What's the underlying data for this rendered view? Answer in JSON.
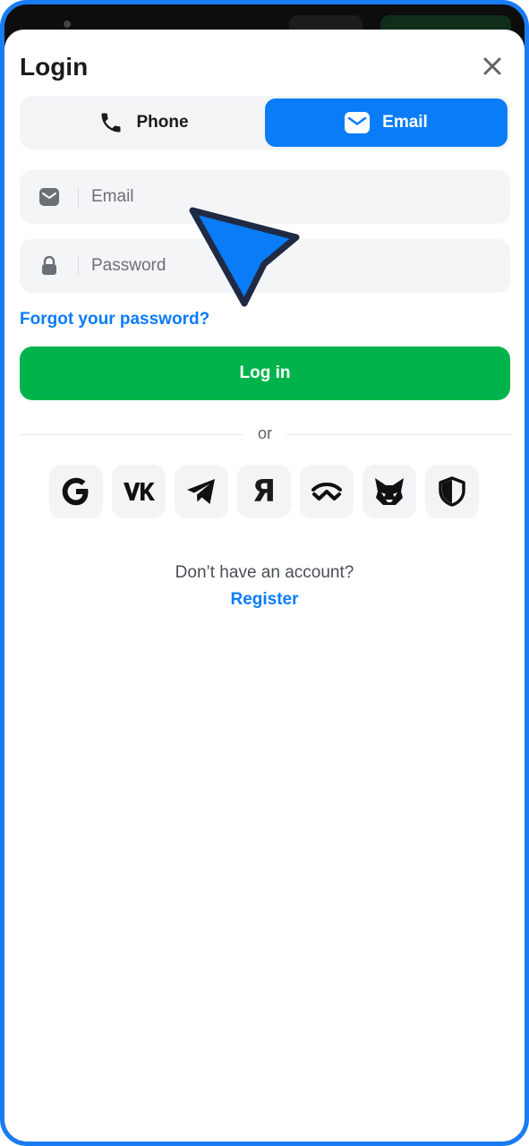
{
  "dialog": {
    "title": "Login"
  },
  "tabs": [
    {
      "label": "Phone",
      "icon": "phone-icon",
      "active": false
    },
    {
      "label": "Email",
      "icon": "envelope-icon",
      "active": true
    }
  ],
  "form": {
    "email_placeholder": "Email",
    "email_value": "",
    "password_placeholder": "Password",
    "password_value": "",
    "forgot_label": "Forgot your password?",
    "login_label": "Log in"
  },
  "divider_label": "or",
  "socials": [
    {
      "icon": "google-icon"
    },
    {
      "icon": "vk-icon"
    },
    {
      "icon": "telegram-icon"
    },
    {
      "icon": "yandex-icon",
      "glyph": "Я"
    },
    {
      "icon": "walletconnect-icon"
    },
    {
      "icon": "metamask-fox-icon"
    },
    {
      "icon": "shield-icon"
    }
  ],
  "footer": {
    "no_account": "Don’t have an account?",
    "register_label": "Register"
  },
  "colors": {
    "accent": "#0a7cf8",
    "login_green": "#00b44b",
    "frame": "#1a7cf5"
  }
}
